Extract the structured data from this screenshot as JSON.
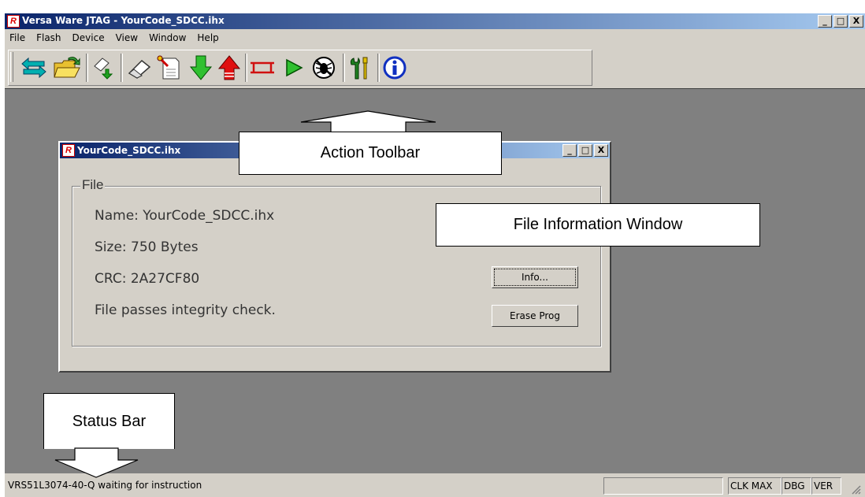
{
  "window": {
    "title": "Versa Ware JTAG - YourCode_SDCC.ihx",
    "icon_letter": "R"
  },
  "caption_buttons": {
    "minimize": "_",
    "maximize": "□",
    "close": "X"
  },
  "menu": [
    "File",
    "Flash",
    "Device",
    "View",
    "Window",
    "Help"
  ],
  "toolbar": {
    "buttons": [
      "connect",
      "open-file",
      "erase-device",
      "erase",
      "blank-check",
      "program",
      "read",
      "reset",
      "run",
      "debug",
      "settings",
      "about"
    ]
  },
  "child": {
    "title": "YourCode_SDCC.ihx",
    "group_label": "File",
    "name_line": "Name: YourCode_SDCC.ihx",
    "size_line": "Size: 750 Bytes",
    "crc_line": "CRC: 2A27CF80",
    "integrity_line": "File passes integrity check.",
    "info_button": "Info...",
    "erase_button": "Erase Prog"
  },
  "callouts": {
    "toolbar": "Action Toolbar",
    "file_info": "File Information Window",
    "status": "Status Bar"
  },
  "status": {
    "message": "VRS51L3074-40-Q waiting for instruction",
    "clk": "CLK MAX",
    "dbg": "DBG",
    "ver": "VER"
  },
  "colors": {
    "titlebar_start": "#0a246a",
    "titlebar_end": "#a6caf0",
    "client_bg": "#808080",
    "face": "#d4d0c8"
  }
}
